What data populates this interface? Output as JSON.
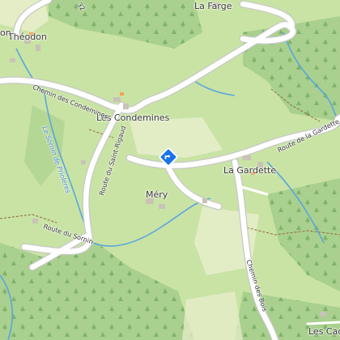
{
  "map": {
    "place_labels": {
      "theodon": "Théodon",
      "la_farge": "La Farge",
      "les_condemines": "Les Condemines",
      "mery": "Méry",
      "la_gardette": "La Gardette",
      "les_cad": "Les Cad",
      "top_left_partial": "on"
    },
    "road_labels": {
      "chemin_condemines": "Chemin des Condemines",
      "route_saint_rigaud": "Route du Saint-Rigaud",
      "route_de_la_gardette": "Route de la Gardette",
      "route_du_sornin": "Route du Sornin",
      "chemin_des_bois": "Chemin des Bois",
      "top_number": "32"
    },
    "water_labels": {
      "sornin_prioleres": "Le Sornin de Prioleres"
    },
    "marker": {
      "icon": "directions-diamond-icon",
      "color": "#1a73e8"
    },
    "colors": {
      "meadow": "#c9e3a4",
      "forest": "#a9d08e",
      "clearing": "#e9eecd",
      "road": "#ffffff",
      "road_casing": "#c8c8c8",
      "stream": "#5aa6de",
      "building": "#c8c2b8"
    }
  }
}
